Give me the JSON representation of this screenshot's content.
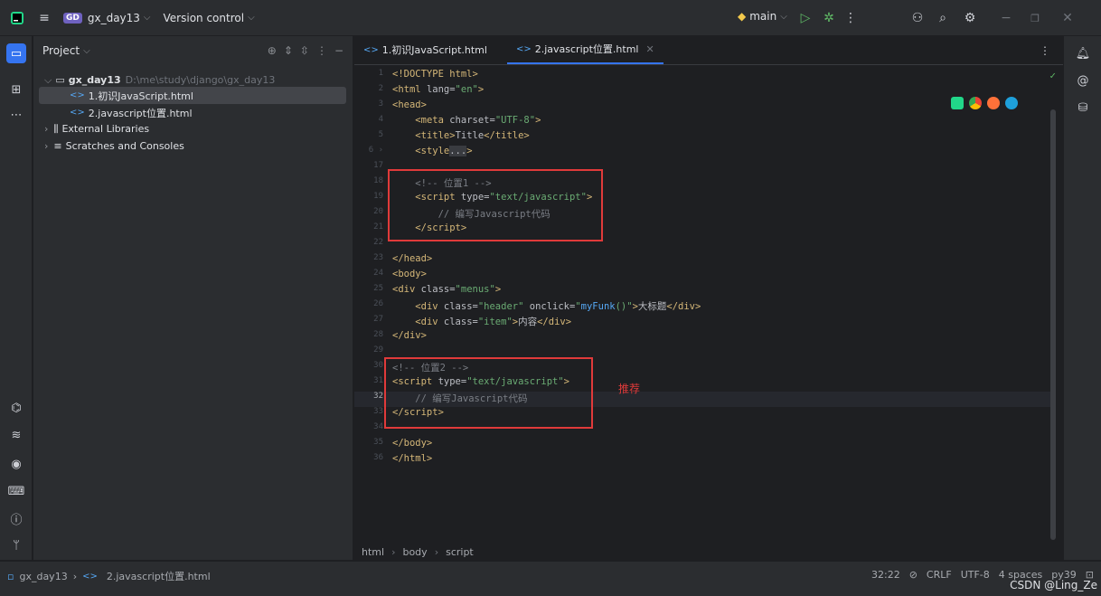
{
  "topbar": {
    "project_badge": "GD",
    "project_name": "gx_day13",
    "version_control": "Version control",
    "branch": "main"
  },
  "project_panel": {
    "title": "Project",
    "root_name": "gx_day13",
    "root_path": "D:\\me\\study\\django\\gx_day13",
    "files": [
      "1.初识JavaScript.html",
      "2.javascript位置.html"
    ],
    "external_libraries": "External Libraries",
    "scratches": "Scratches and Consoles"
  },
  "tabs": [
    {
      "label": "1.初识JavaScript.html"
    },
    {
      "label": "2.javascript位置.html"
    }
  ],
  "editor": {
    "annotation": "推荐"
  },
  "breadcrumbs": [
    "html",
    "body",
    "script"
  ],
  "status": {
    "project": "gx_day13",
    "file": "2.javascript位置.html",
    "position": "32:22",
    "line_sep": "CRLF",
    "encoding": "UTF-8",
    "indent": "4 spaces",
    "interpreter": "py39",
    "watermark": "CSDN @Ling_Ze"
  },
  "colors": {
    "accent": "#3574f0",
    "highlight_box": "#e03a3a"
  }
}
